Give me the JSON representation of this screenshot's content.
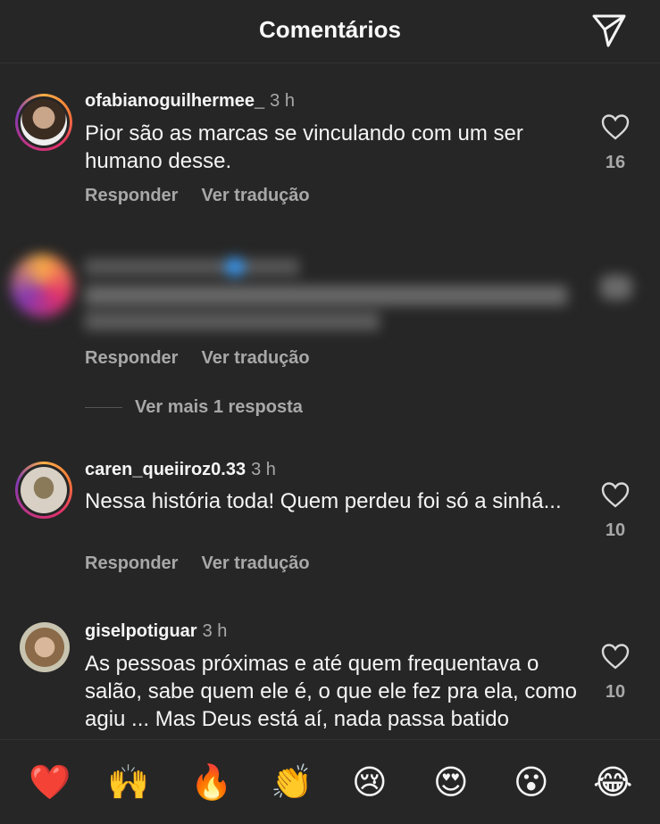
{
  "header": {
    "title": "Comentários",
    "send_icon": "paper-plane-icon"
  },
  "comments": [
    {
      "username": "ofabianoguilhermee_",
      "time": "3 h",
      "text": "Pior são as marcas se vinculando com um ser humano desse.",
      "reply_label": "Responder",
      "translate_label": "Ver tradução",
      "likes": "16"
    },
    {
      "blurred": true,
      "reply_label": "Responder",
      "translate_label": "Ver tradução",
      "view_more": "Ver mais 1 resposta"
    },
    {
      "username": "caren_queiiroz0.33",
      "time": "3 h",
      "text": "Nessa história toda! Quem perdeu foi só a sinhá...",
      "reply_label": "Responder",
      "translate_label": "Ver tradução",
      "likes": "10"
    },
    {
      "username": "giselpotiguar",
      "time": "3 h",
      "text": "As pessoas próximas e até quem frequentava o salão, sabe quem ele é, o que ele fez pra ela, como agiu ... Mas Deus está aí, nada passa batido",
      "likes": "10"
    }
  ],
  "reactions": [
    "❤️",
    "🙌",
    "🔥",
    "👏",
    "😢",
    "😍",
    "😮",
    "😂"
  ],
  "colors": {
    "background": "#262626",
    "text": "#f5f5f5",
    "muted": "#a8a8a8"
  }
}
